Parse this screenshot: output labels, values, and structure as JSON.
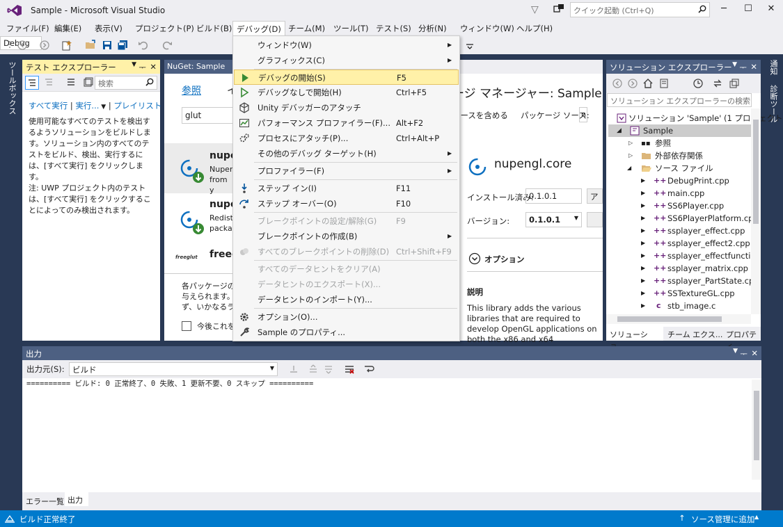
{
  "titlebar": {
    "title": "Sample - Microsoft Visual Studio",
    "quick_launch_placeholder": "クイック起動 (Ctrl+Q)"
  },
  "menubar": {
    "items": [
      "ファイル(F)",
      "編集(E)",
      "表示(V)",
      "プロジェクト(P)",
      "ビルド(B)",
      "デバッグ(D)",
      "チーム(M)",
      "ツール(T)",
      "テスト(S)",
      "分析(N)",
      "ウィンドウ(W)",
      "ヘルプ(H)"
    ]
  },
  "toolbar": {
    "config": "Debug"
  },
  "left_rail": {
    "label": "ツールボックス"
  },
  "right_rail": {
    "labels": [
      "通知",
      "診断ツール"
    ]
  },
  "test_explorer": {
    "title": "テスト エクスプローラー",
    "search_placeholder": "検索",
    "run_all": "すべて実行",
    "run": "実行...",
    "playlist": "プレイリスト",
    "info1": "使用可能なすべてのテストを検出するようソリューションをビルドします。ソリューション内のすべてのテストをビルド、検出、実行するには、[すべて実行] をクリックします。",
    "info2": "注: UWP プロジェクト内のテストは、[すべて実行] をクリックすることによってのみ検出されます。"
  },
  "nuget": {
    "tab_title": "NuGet: Sample",
    "browse": "参照",
    "installed_partial": "イ",
    "search_value": "glut",
    "manager_title": "ージ マネージャー: Sample",
    "prerelease_label": "リースを含める",
    "source_label": "パッケージ ソース:",
    "source_value": "n",
    "packages": [
      {
        "name": "nupe",
        "desc1": "Nuper",
        "desc2": "from y"
      },
      {
        "name": "nupe",
        "desc1": "Redist",
        "desc2": "packa"
      },
      {
        "name": "freegl",
        "logo_text": "freeglut"
      }
    ],
    "footer_text1": "各パッケージのラ",
    "footer_text2": "与えられます。Nu",
    "footer_text3": "ず、いかなるライ",
    "footer_checkbox": "今後これを",
    "detail": {
      "name": "nupengl.core",
      "installed_label": "インストール済み:",
      "installed_value": "0.1.0.1",
      "uninstall_partial": "ア",
      "version_label": "バージョン:",
      "version_value": "0.1.0.1",
      "options_label": "オプション",
      "description_heading": "説明",
      "description": "This library adds the various libraries that are required to develop OpenGL applications on both the x86 and x64 architectures. Includes GLFW and GLEW."
    }
  },
  "solution_explorer": {
    "title": "ソリューション エクスプローラー",
    "search_placeholder": "ソリューション エクスプローラーの検索 (C",
    "solution": "ソリューション 'Sample' (1 プロジェクト",
    "project": "Sample",
    "references": "参照",
    "external_deps": "外部依存関係",
    "source_files": "ソース ファイル",
    "files": [
      "DebugPrint.cpp",
      "main.cpp",
      "SS6Player.cpp",
      "SS6PlayerPlatform.cpp",
      "ssplayer_effect.cpp",
      "ssplayer_effect2.cpp",
      "ssplayer_effectfunctio",
      "ssplayer_matrix.cpp",
      "ssplayer_PartState.cpp",
      "SSTextureGL.cpp",
      "stb_image.c"
    ],
    "tabs": [
      "ソリューショ...",
      "チーム エクス...",
      "プロパティ"
    ]
  },
  "output": {
    "title": "出力",
    "source_label": "出力元(S):",
    "source_value": "ビルド",
    "text": "========== ビルド: 0 正常終了、0 失敗、1 更新不要、0 スキップ ==========",
    "tabs": [
      "エラー一覧",
      "出力"
    ]
  },
  "statusbar": {
    "status": "ビルド正常終了",
    "source_control": "ソース管理に追加"
  },
  "debug_menu": {
    "items": [
      {
        "label": "ウィンドウ(W)",
        "shortcut": "",
        "submenu": true
      },
      {
        "label": "グラフィックス(C)",
        "shortcut": "",
        "submenu": true
      },
      {
        "label": "デバッグの開始(S)",
        "shortcut": "F5",
        "submenu": false
      },
      {
        "label": "デバッグなしで開始(H)",
        "shortcut": "Ctrl+F5",
        "submenu": false
      },
      {
        "label": "Unity デバッガーのアタッチ",
        "shortcut": "",
        "submenu": false
      },
      {
        "label": "パフォーマンス プロファイラー(F)...",
        "shortcut": "Alt+F2",
        "submenu": false
      },
      {
        "label": "プロセスにアタッチ(P)...",
        "shortcut": "Ctrl+Alt+P",
        "submenu": false
      },
      {
        "label": "その他のデバッグ ターゲット(H)",
        "shortcut": "",
        "submenu": true
      },
      {
        "label": "プロファイラー(F)",
        "shortcut": "",
        "submenu": true
      },
      {
        "label": "ステップ イン(I)",
        "shortcut": "F11",
        "submenu": false
      },
      {
        "label": "ステップ オーバー(O)",
        "shortcut": "F10",
        "submenu": false
      },
      {
        "label": "ブレークポイントの設定/解除(G)",
        "shortcut": "F9",
        "submenu": false
      },
      {
        "label": "ブレークポイントの作成(B)",
        "shortcut": "",
        "submenu": true
      },
      {
        "label": "すべてのブレークポイントの削除(D)",
        "shortcut": "Ctrl+Shift+F9",
        "submenu": false
      },
      {
        "label": "すべてのデータヒントをクリア(A)",
        "shortcut": "",
        "submenu": false
      },
      {
        "label": "データヒントのエクスポート(X)...",
        "shortcut": "",
        "submenu": false
      },
      {
        "label": "データヒントのインポート(Y)...",
        "shortcut": "",
        "submenu": false
      },
      {
        "label": "オプション(O)...",
        "shortcut": "",
        "submenu": false
      },
      {
        "label": "Sample のプロパティ...",
        "shortcut": "",
        "submenu": false
      }
    ]
  },
  "colors": {
    "accent": "#007acc",
    "menu_highlight": "#fff1a8",
    "vs_purple": "#68217a",
    "frame_dark": "#293955"
  }
}
